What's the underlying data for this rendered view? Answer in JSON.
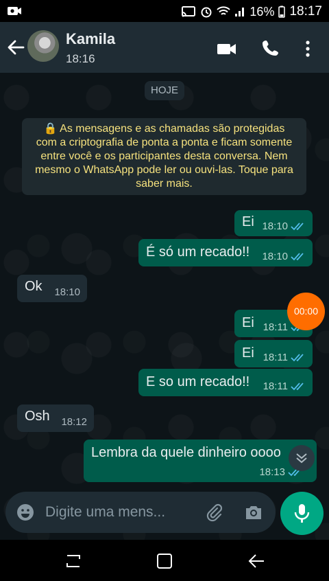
{
  "status_bar": {
    "battery": "16%",
    "time": "18:17"
  },
  "header": {
    "name": "Kamila",
    "time": "18:16"
  },
  "chat": {
    "date_chip": "HOJE",
    "encryption_lines": [
      "🔒 As mensagens e as chamadas são protegidas",
      "com a criptografia de ponta a ponta e ficam somente",
      "entre você e os participantes desta conversa. Nem",
      "mesmo o WhatsApp pode ler ou ouvi-las. Toque para",
      "saber mais."
    ],
    "messages": [
      {
        "dir": "out",
        "text": "Ei",
        "time": "18:10"
      },
      {
        "dir": "out",
        "text": "É só um recado!!",
        "time": "18:10"
      },
      {
        "dir": "in",
        "text": "Ok",
        "time": "18:10"
      },
      {
        "dir": "out",
        "text": "Ei",
        "time": "18:11"
      },
      {
        "dir": "out",
        "text": "Ei",
        "time": "18:11"
      },
      {
        "dir": "out",
        "text": "E so um recado!!",
        "time": "18:11"
      },
      {
        "dir": "in",
        "text": "Osh",
        "time": "18:12"
      },
      {
        "dir": "out",
        "text": "Lembra da quele dinheiro  oooo",
        "time": "18:13"
      }
    ],
    "recording_timer": "00:00"
  },
  "input": {
    "placeholder": "Digite uma mens..."
  },
  "colors": {
    "outgoing": "#005c4b",
    "incoming": "#1f2c34",
    "accent": "#00a884",
    "record": "#ff6d00"
  }
}
